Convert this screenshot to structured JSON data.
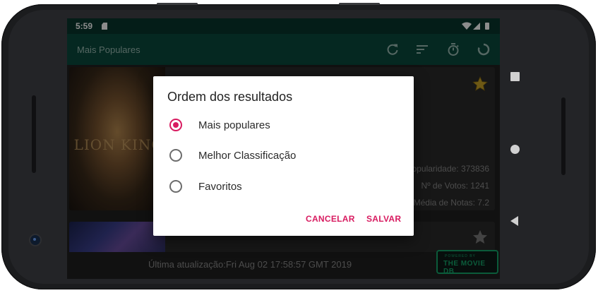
{
  "status_bar": {
    "time": "5:59"
  },
  "app_bar": {
    "title": "Mais Populares",
    "actions": [
      {
        "icon": "refresh-icon"
      },
      {
        "icon": "sort-icon"
      },
      {
        "icon": "timer-icon"
      },
      {
        "icon": "loading-icon"
      }
    ]
  },
  "movies": [
    {
      "poster_text": "LION KING",
      "favorite_icon": "star-icon",
      "favorite_color": "#c9a227",
      "stats": [
        "Popularidade: 373836",
        "Nº de Votos: 1241",
        "Média de Notas: 7.2"
      ]
    },
    {
      "favorite_icon": "star-icon",
      "favorite_color": "#7a7a7a"
    }
  ],
  "footer": {
    "last_update": "Última atualização:Fri Aug 02 17:58:57 GMT 2019",
    "tmdb_badge": {
      "small": "POWERED BY",
      "big": "THE MOVIE DB"
    }
  },
  "dialog": {
    "title": "Ordem dos resultados",
    "options": [
      {
        "label": "Mais populares",
        "checked": true
      },
      {
        "label": "Melhor Classificação",
        "checked": false
      },
      {
        "label": "Favoritos",
        "checked": false
      }
    ],
    "cancel_label": "CANCELAR",
    "save_label": "SALVAR"
  },
  "colors": {
    "accent": "#d81b60",
    "app_bar": "#0a4a3c",
    "status_bar": "#08352c",
    "tmdb_green": "#14a66a"
  },
  "nav_bar": {
    "icons": [
      "recents-icon",
      "home-icon",
      "back-icon"
    ]
  }
}
